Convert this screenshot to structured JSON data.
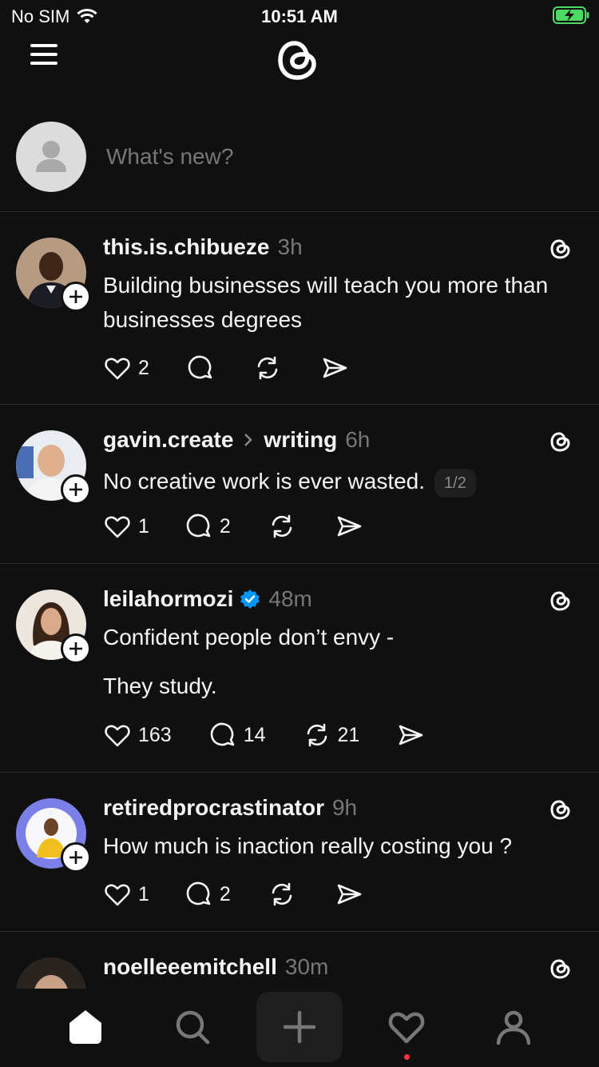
{
  "status": {
    "carrier": "No SIM",
    "time": "10:51 AM",
    "battery_color": "#4cd964"
  },
  "composer": {
    "placeholder": "What's new?"
  },
  "posts": [
    {
      "username": "this.is.chibueze",
      "time": "3h",
      "text": "Building businesses will teach you more than businesses degrees",
      "likes": "2",
      "replies": "",
      "reposts": ""
    },
    {
      "username": "gavin.create",
      "topic": "writing",
      "time": "6h",
      "text": "No creative work is ever wasted.",
      "page": "1/2",
      "likes": "1",
      "replies": "2",
      "reposts": ""
    },
    {
      "username": "leilahormozi",
      "verified": true,
      "time": "48m",
      "text_line1": "Confident people don’t envy -",
      "text_line2": "They study.",
      "likes": "163",
      "replies": "14",
      "reposts": "21"
    },
    {
      "username": "retiredprocrastinator",
      "time": "9h",
      "text": "How much is inaction really costing you ?",
      "likes": "1",
      "replies": "2",
      "reposts": ""
    },
    {
      "username": "noelleeemitchell",
      "time": "30m"
    }
  ],
  "tabs": [
    "home-icon",
    "search-icon",
    "new-thread-icon",
    "activity-icon",
    "profile-icon"
  ],
  "colors": {
    "background": "#101010",
    "text": "#f3f5f7",
    "muted": "#777777",
    "verified": "#0095f6",
    "notification": "#ff3040"
  }
}
